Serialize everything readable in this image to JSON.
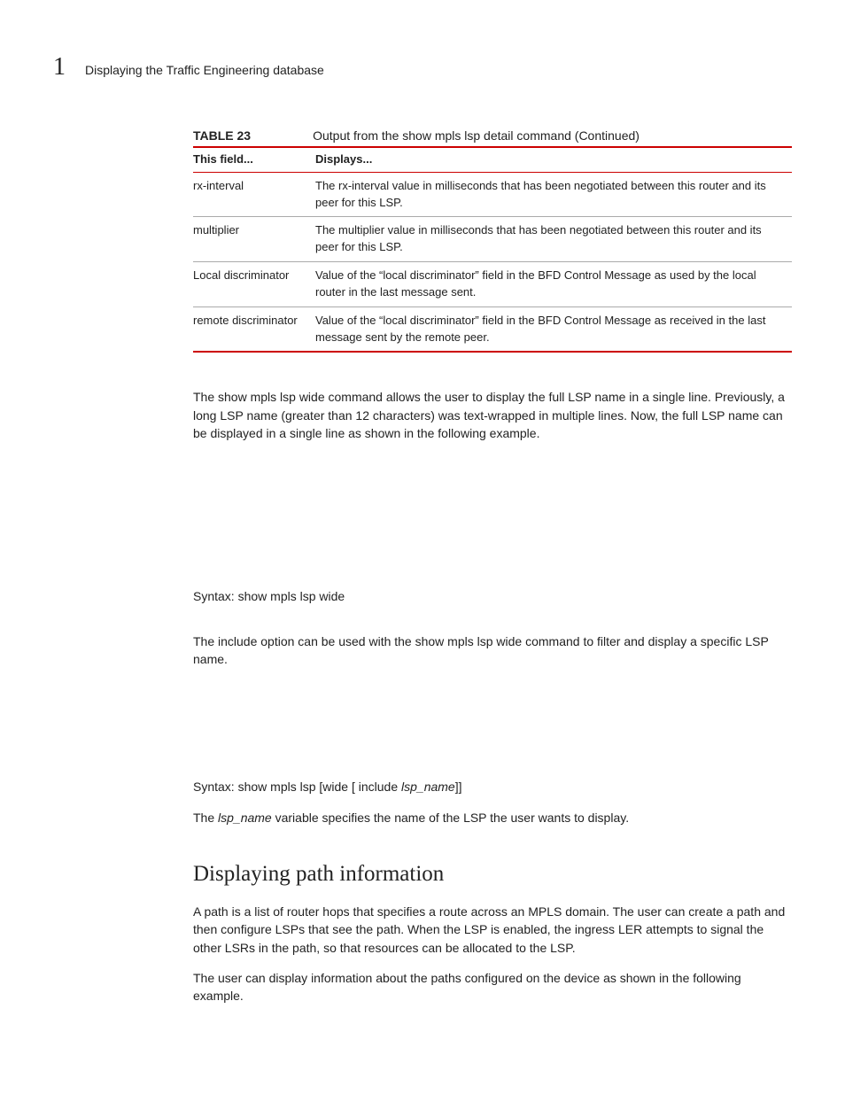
{
  "running_head": {
    "number": "1",
    "title": "Displaying the Traffic Engineering database"
  },
  "table": {
    "label": "TABLE 23",
    "caption": "Output from the show mpls lsp detail command  (Continued)",
    "head_field": "This field...",
    "head_desc": "Displays...",
    "rows": [
      {
        "field": "rx-interval",
        "desc": "The rx-interval value in milliseconds that has been negotiated between this router and its peer for this LSP."
      },
      {
        "field": "multiplier",
        "desc": "The multiplier value in milliseconds that has been negotiated between this router and its peer for this LSP."
      },
      {
        "field": "Local discriminator",
        "desc": "Value of the “local discriminator” field in the BFD Control Message as used by the local router in the last message sent."
      },
      {
        "field": "remote discriminator",
        "desc": "Value of the “local discriminator” field in the BFD Control Message as received in the last message sent by the remote peer."
      }
    ]
  },
  "para1": "The show mpls lsp wide command allows the user to display the full LSP name in a single line. Previously, a long LSP name (greater than 12 characters) was text-wrapped in multiple lines. Now, the full LSP name can be displayed in a single line as shown in the following example.",
  "syntax1_label": "Syntax:  ",
  "syntax1_cmd": "show mpls lsp wide",
  "para2": "The include option can be used with the show mpls lsp wide command to filter and display a specific LSP name.",
  "syntax2_label": "Syntax:  ",
  "syntax2_cmd_pre": "show mpls lsp [wide [ include ",
  "syntax2_var": "lsp_name",
  "syntax2_cmd_post": "]]",
  "para3_pre": "The ",
  "para3_var": "lsp_name",
  "para3_post": " variable specifies the name of the LSP the user wants to display.",
  "section_heading": "Displaying path information",
  "para4": "A path is a list of router hops that specifies a route across an MPLS domain. The user can create a path and then configure LSPs that see the path. When the LSP is enabled, the ingress LER attempts to signal the other LSRs in the path, so that resources can be allocated to the LSP.",
  "para5": "The user can display information about the paths configured on the device as shown in the following example."
}
